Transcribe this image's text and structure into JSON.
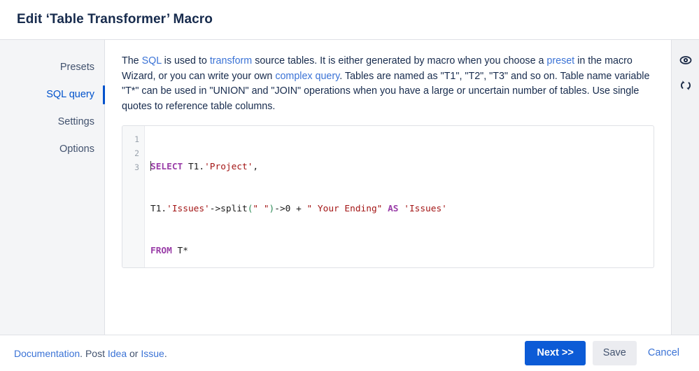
{
  "header": {
    "title": "Edit ‘Table Transformer’ Macro"
  },
  "sidebar": {
    "items": [
      {
        "label": "Presets",
        "active": false
      },
      {
        "label": "SQL query",
        "active": true
      },
      {
        "label": "Settings",
        "active": false
      },
      {
        "label": "Options",
        "active": false
      }
    ]
  },
  "description": {
    "p1_a": "The ",
    "link_sql": "SQL",
    "p1_b": " is used to ",
    "link_transform": "transform",
    "p1_c": " source tables. It is either generated by macro when you choose a ",
    "link_preset": "preset",
    "p1_d": " in the macro Wizard, or you can write your own ",
    "link_complex_query": "complex query",
    "p1_e": ". Tables are named as \"T1\", \"T2\", \"T3\" and so on. Table name variable \"T*\" can be used in \"UNION\" and \"JOIN\" operations when you have a large or uncertain number of tables. Use single quotes to reference table columns."
  },
  "editor": {
    "line_numbers": [
      "1",
      "2",
      "3"
    ],
    "lines": [
      {
        "number": "1",
        "tokens": [
          {
            "text": "SELECT",
            "type": "kw"
          },
          {
            "text": " ",
            "type": "plain"
          },
          {
            "text": "T1.",
            "type": "plain"
          },
          {
            "text": "'Project'",
            "type": "str"
          },
          {
            "text": ",",
            "type": "plain"
          }
        ]
      },
      {
        "number": "2",
        "tokens": [
          {
            "text": "T1.",
            "type": "plain"
          },
          {
            "text": "'Issues'",
            "type": "str"
          },
          {
            "text": "->split",
            "type": "plain"
          },
          {
            "text": "(",
            "type": "punct"
          },
          {
            "text": "\" \"",
            "type": "str"
          },
          {
            "text": ")",
            "type": "punct"
          },
          {
            "text": "->0 + ",
            "type": "plain"
          },
          {
            "text": "\" Your Ending\"",
            "type": "str"
          },
          {
            "text": " ",
            "type": "plain"
          },
          {
            "text": "AS",
            "type": "kw"
          },
          {
            "text": " ",
            "type": "plain"
          },
          {
            "text": "'Issues'",
            "type": "str"
          }
        ]
      },
      {
        "number": "3",
        "tokens": [
          {
            "text": "FROM",
            "type": "kw"
          },
          {
            "text": " ",
            "type": "plain"
          },
          {
            "text": "T*",
            "type": "plain"
          }
        ]
      }
    ],
    "full_text": "SELECT T1.'Project',\nT1.'Issues'->split(\" \")->0 + \" Your Ending\" AS 'Issues'\nFROM T*"
  },
  "right_rail": {
    "icons": [
      {
        "name": "eye-icon",
        "title": "Preview"
      },
      {
        "name": "refresh-icon",
        "title": "Refresh"
      }
    ]
  },
  "footer": {
    "link_documentation": "Documentation",
    "text_mid_1": ". Post ",
    "link_idea": "Idea",
    "text_mid_2": " or ",
    "link_issue": "Issue",
    "text_end": ".",
    "btn_next": "Next >>",
    "btn_save": "Save",
    "btn_cancel": "Cancel"
  },
  "colors": {
    "accent": "#0052cc",
    "primary_button": "#0c5bd6",
    "link": "#3b73d6",
    "sidebar_bg": "#f4f5f7",
    "keyword": "#9a3ea8",
    "string": "#a31515"
  }
}
